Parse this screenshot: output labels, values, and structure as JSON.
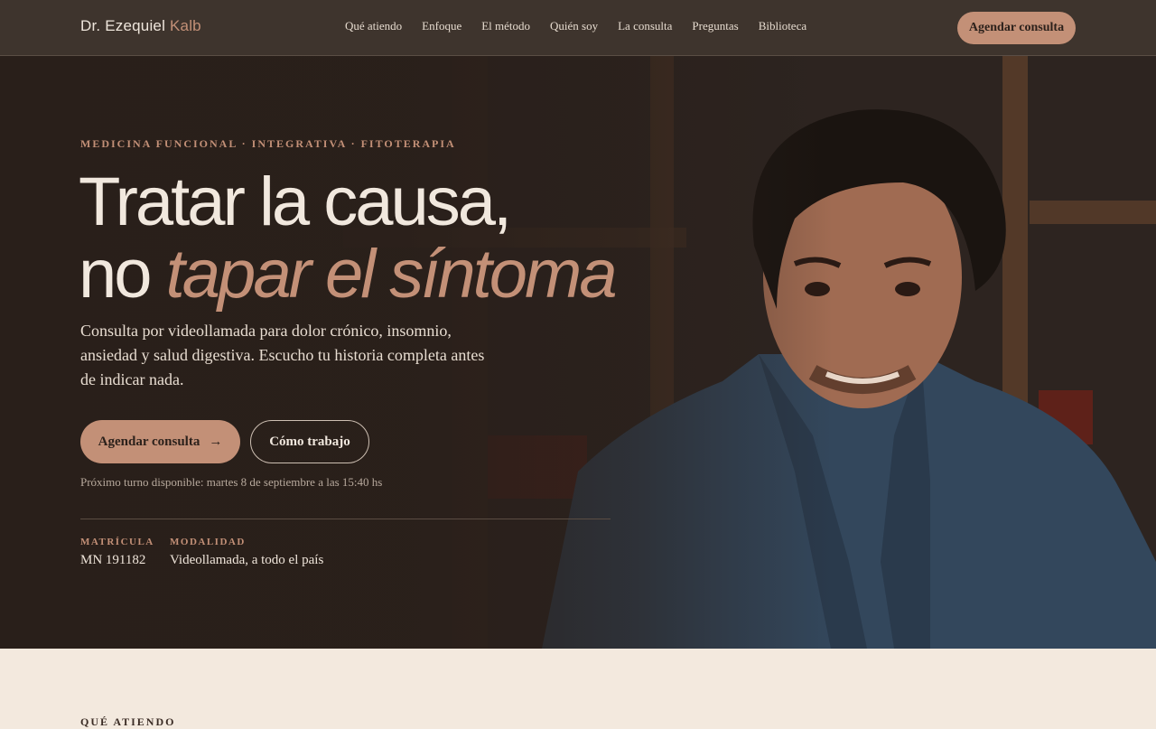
{
  "nav": {
    "brand_first": "Dr. Ezequiel",
    "brand_last": "Kalb",
    "links": [
      "Qué atiendo",
      "Enfoque",
      "El método",
      "Quién soy",
      "La consulta",
      "Preguntas",
      "Biblioteca"
    ],
    "cta": "Agendar consulta"
  },
  "hero": {
    "eyebrow": "MEDICINA FUNCIONAL · INTEGRATIVA · FITOTERAPIA",
    "title_line1": "Tratar la causa,",
    "title_line2_plain": "no",
    "title_line2_em": "tapar el síntoma",
    "lede": "Consulta por videollamada para dolor crónico, insomnio, ansiedad y salud digestiva. Escucho tu historia completa antes de indicar nada.",
    "primary_cta": "Agendar consulta",
    "primary_cta_arrow": "→",
    "secondary_cta": "Cómo trabajo",
    "next_slot": "Próximo turno disponible: martes 8 de septiembre a las 15:40 hs",
    "meta": [
      {
        "label": "MATRÍCULA",
        "value": "MN 191182"
      },
      {
        "label": "MODALIDAD",
        "value": "Videollamada, a todo el país"
      }
    ],
    "photo_icon": "portrait-photo"
  },
  "section": {
    "eyebrow": "QUÉ ATIENDO"
  }
}
